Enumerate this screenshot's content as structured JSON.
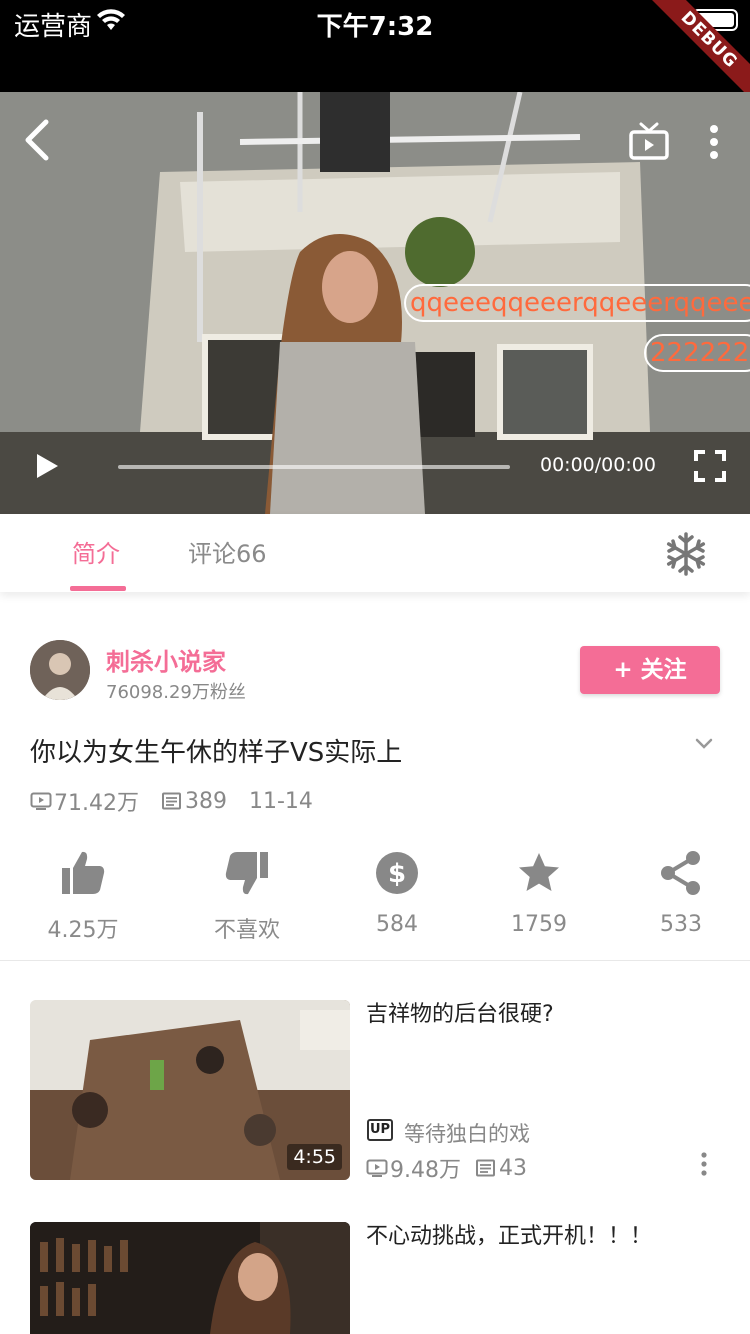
{
  "status_bar": {
    "carrier": "运营商",
    "time": "下午7:32",
    "debug_label": "DEBUG"
  },
  "player": {
    "danmaku": [
      {
        "text": "qqeeeqqeeerqqeeerqqeeerqqeee"
      },
      {
        "text": "222222"
      }
    ],
    "time": "00:00/00:00",
    "progress": 0,
    "danmaku_color": "#ff6a3d"
  },
  "tabs": [
    {
      "label": "简介",
      "active": true
    },
    {
      "label": "评论66",
      "active": false
    }
  ],
  "accent_color": "#f46d96",
  "author": {
    "name": "刺杀小说家",
    "fans": "76098.29万粉丝",
    "follow_label": "+ 关注"
  },
  "video": {
    "title": "你以为女生午休的样子VS实际上",
    "views": "71.42万",
    "danmaku_count": "389",
    "date": "11-14"
  },
  "actions": [
    {
      "icon": "thumbs-up-icon",
      "label": "4.25万"
    },
    {
      "icon": "thumbs-down-icon",
      "label": "不喜欢"
    },
    {
      "icon": "coin-icon",
      "label": "584"
    },
    {
      "icon": "star-icon",
      "label": "1759"
    },
    {
      "icon": "share-icon",
      "label": "533"
    }
  ],
  "recommendations": [
    {
      "title": "吉祥物的后台很硬?",
      "duration": "4:55",
      "up_badge": "UP",
      "uploader": "等待独白的戏",
      "views": "9.48万",
      "danmaku_count": "43"
    },
    {
      "title": "不心动挑战，正式开机！！！"
    }
  ]
}
